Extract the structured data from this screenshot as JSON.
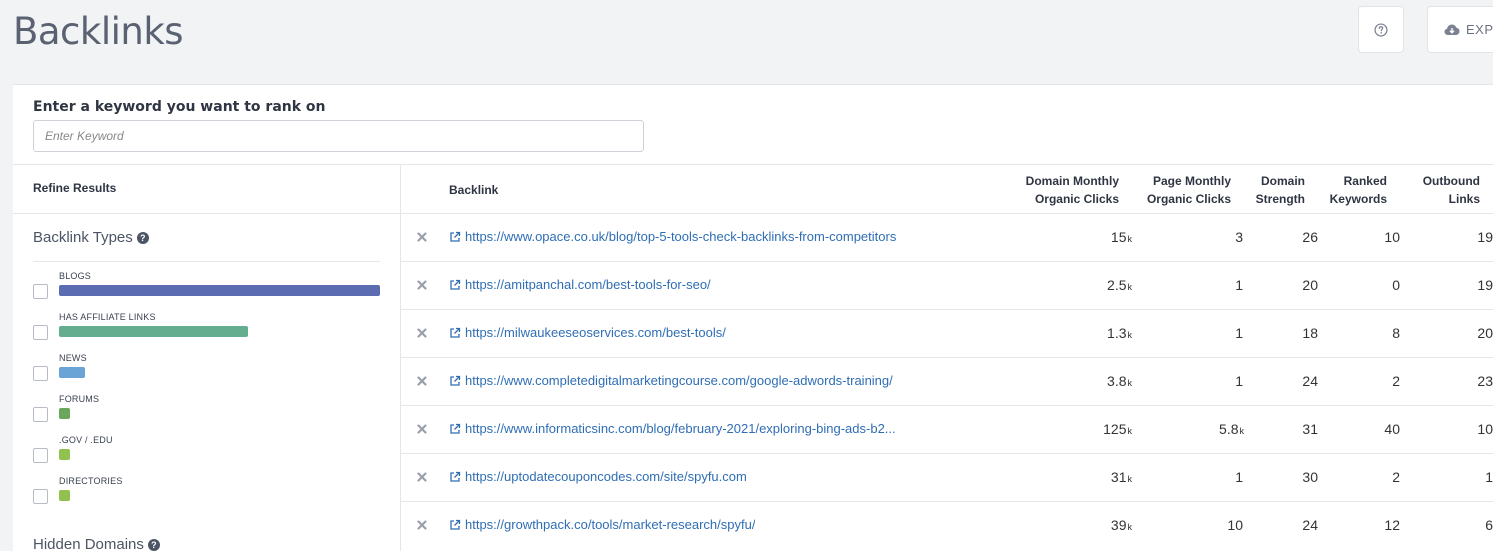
{
  "page": {
    "title": "Backlinks"
  },
  "toolbar": {
    "help_label": "?",
    "export_label": "EXPORT"
  },
  "keyword": {
    "label": "Enter a keyword you want to rank on",
    "placeholder": "Enter Keyword",
    "value": ""
  },
  "refine": {
    "header": "Refine Results",
    "backlink_types_title": "Backlink Types",
    "hidden_domains_title": "Hidden Domains",
    "types": [
      {
        "label": "BLOGS",
        "fraction": 1.0,
        "color": "#5b6cb2"
      },
      {
        "label": "HAS AFFILIATE LINKS",
        "fraction": 0.59,
        "color": "#64ad8e"
      },
      {
        "label": "NEWS",
        "fraction": 0.08,
        "color": "#6aa3d6"
      },
      {
        "label": "FORUMS",
        "fraction": 0.03,
        "color": "#6aa65b"
      },
      {
        "label": ".GOV / .EDU",
        "fraction": 0.03,
        "color": "#93c150"
      },
      {
        "label": "DIRECTORIES",
        "fraction": 0.03,
        "color": "#93c150"
      }
    ]
  },
  "table": {
    "headers": {
      "backlink": "Backlink",
      "domain_clicks": [
        "Domain Monthly",
        "Organic Clicks"
      ],
      "page_clicks": [
        "Page Monthly",
        "Organic Clicks"
      ],
      "domain_strength": [
        "Domain",
        "Strength"
      ],
      "ranked_keywords": [
        "Ranked",
        "Keywords"
      ],
      "outbound_links": [
        "Outbound",
        "Links"
      ]
    },
    "rows": [
      {
        "url": "https://www.opace.co.uk/blog/top-5-tools-check-backlinks-from-competitors",
        "domain_clicks": "15",
        "domain_clicks_unit": "k",
        "page_clicks": "3",
        "page_clicks_unit": "",
        "domain_strength": "26",
        "ranked_keywords": "10",
        "outbound_links": "19"
      },
      {
        "url": "https://amitpanchal.com/best-tools-for-seo/",
        "domain_clicks": "2.5",
        "domain_clicks_unit": "k",
        "page_clicks": "1",
        "page_clicks_unit": "",
        "domain_strength": "20",
        "ranked_keywords": "0",
        "outbound_links": "19"
      },
      {
        "url": "https://milwaukeeseoservices.com/best-tools/",
        "domain_clicks": "1.3",
        "domain_clicks_unit": "k",
        "page_clicks": "1",
        "page_clicks_unit": "",
        "domain_strength": "18",
        "ranked_keywords": "8",
        "outbound_links": "20"
      },
      {
        "url": "https://www.completedigitalmarketingcourse.com/google-adwords-training/",
        "domain_clicks": "3.8",
        "domain_clicks_unit": "k",
        "page_clicks": "1",
        "page_clicks_unit": "",
        "domain_strength": "24",
        "ranked_keywords": "2",
        "outbound_links": "23"
      },
      {
        "url": "https://www.informaticsinc.com/blog/february-2021/exploring-bing-ads-b2...",
        "domain_clicks": "125",
        "domain_clicks_unit": "k",
        "page_clicks": "5.8",
        "page_clicks_unit": "k",
        "domain_strength": "31",
        "ranked_keywords": "40",
        "outbound_links": "10"
      },
      {
        "url": "https://uptodatecouponcodes.com/site/spyfu.com",
        "domain_clicks": "31",
        "domain_clicks_unit": "k",
        "page_clicks": "1",
        "page_clicks_unit": "",
        "domain_strength": "30",
        "ranked_keywords": "2",
        "outbound_links": "1"
      },
      {
        "url": "https://growthpack.co/tools/market-research/spyfu/",
        "domain_clicks": "39",
        "domain_clicks_unit": "k",
        "page_clicks": "10",
        "page_clicks_unit": "",
        "domain_strength": "24",
        "ranked_keywords": "12",
        "outbound_links": "6"
      }
    ]
  }
}
